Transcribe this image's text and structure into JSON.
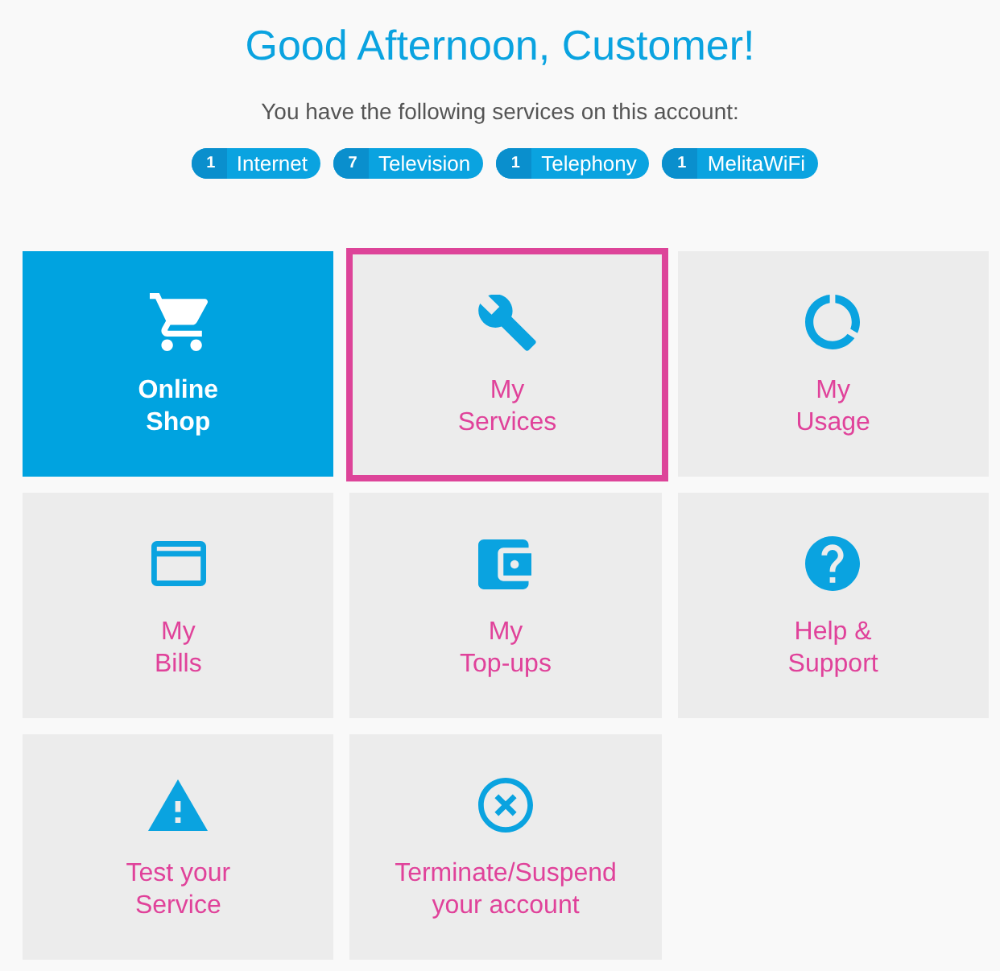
{
  "header": {
    "title": "Good Afternoon, Customer!",
    "subtitle": "You have the following services on this account:"
  },
  "services": [
    {
      "count": "1",
      "name": "Internet"
    },
    {
      "count": "7",
      "name": "Television"
    },
    {
      "count": "1",
      "name": "Telephony"
    },
    {
      "count": "1",
      "name": "MelitaWiFi"
    }
  ],
  "tiles": [
    {
      "kind": "primary",
      "label": "Online\nShop",
      "selected": false
    },
    {
      "kind": "default",
      "label": "My\nServices",
      "selected": true
    },
    {
      "kind": "default",
      "label": "My\nUsage",
      "selected": false
    },
    {
      "kind": "default",
      "label": "My\nBills",
      "selected": false
    },
    {
      "kind": "default",
      "label": "My\nTop-ups",
      "selected": false
    },
    {
      "kind": "default",
      "label": "Help &\nSupport",
      "selected": false
    },
    {
      "kind": "default",
      "label": "Test your\nService",
      "selected": false
    },
    {
      "kind": "default",
      "label": "Terminate/Suspend\nyour account",
      "selected": false
    }
  ]
}
